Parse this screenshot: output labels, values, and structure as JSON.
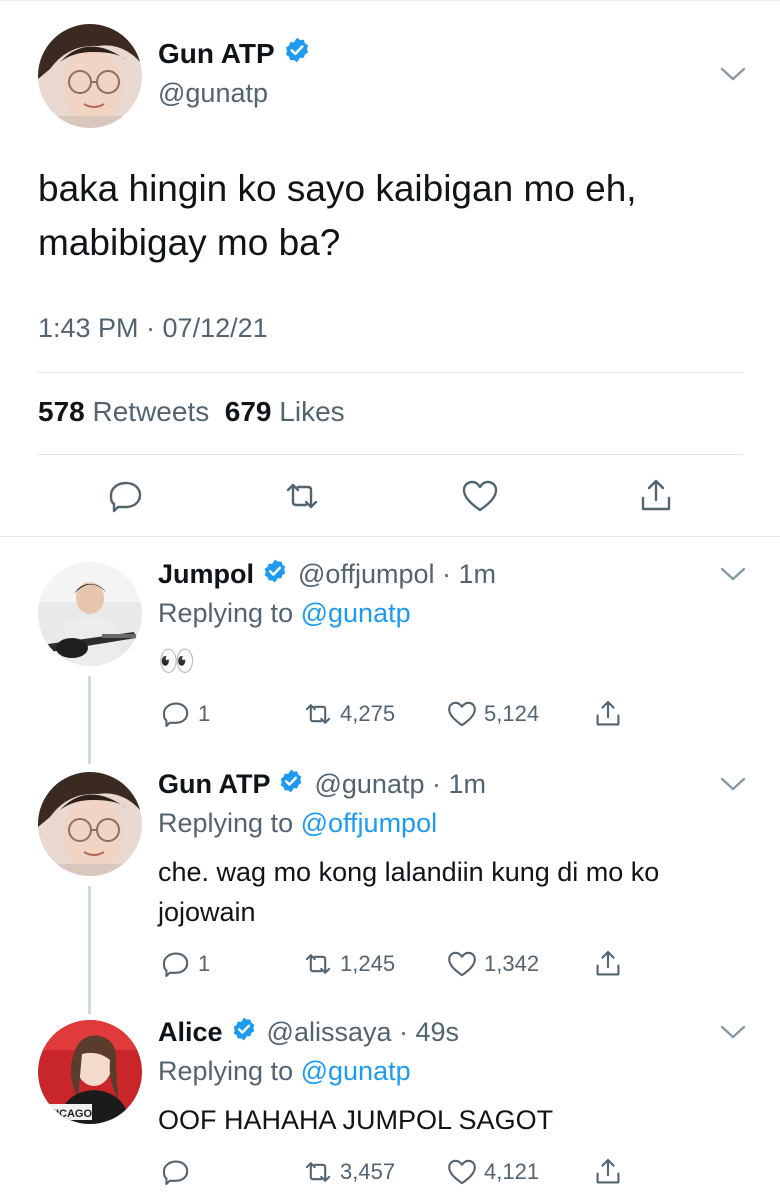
{
  "main_tweet": {
    "author_name": "Gun ATP",
    "handle": "@gunatp",
    "text_line1": "baka hingin ko sayo kaibigan mo eh,",
    "text_line2": "mabibigay mo ba?",
    "timestamp": "1:43 PM · 07/12/21",
    "retweets_count": "578",
    "retweets_label": "Retweets",
    "likes_count": "679",
    "likes_label": "Likes",
    "icons": [
      "reply-icon",
      "retweet-icon",
      "like-icon",
      "share-icon"
    ]
  },
  "replies": [
    {
      "name": "Jumpol",
      "handle_time": "@offjumpol · 1m",
      "replying_prefix": "Replying to",
      "replying_to": "@gunatp",
      "text": "👀",
      "reply_count": "1",
      "retweet_count": "4,275",
      "like_count": "5,124"
    },
    {
      "name": "Gun ATP",
      "handle_time": "@gunatp · 1m",
      "replying_prefix": "Replying to",
      "replying_to": "@offjumpol",
      "text_line1": "che. wag mo kong lalandiin kung di mo ko",
      "text_line2": "jojowain",
      "reply_count": "1",
      "retweet_count": "1,245",
      "like_count": "1,342"
    },
    {
      "name": "Alice",
      "handle_time": "@alissaya · 49s",
      "replying_prefix": "Replying to",
      "replying_to": "@gunatp",
      "text": "OOF HAHAHA JUMPOL SAGOT",
      "reply_count": "",
      "retweet_count": "3,457",
      "like_count": "4,121",
      "avatar_badge_text": "HICAGO"
    }
  ],
  "colors": {
    "verified": "#1d9bf0",
    "link": "#1d9bf0",
    "secondary_text": "#536471"
  }
}
